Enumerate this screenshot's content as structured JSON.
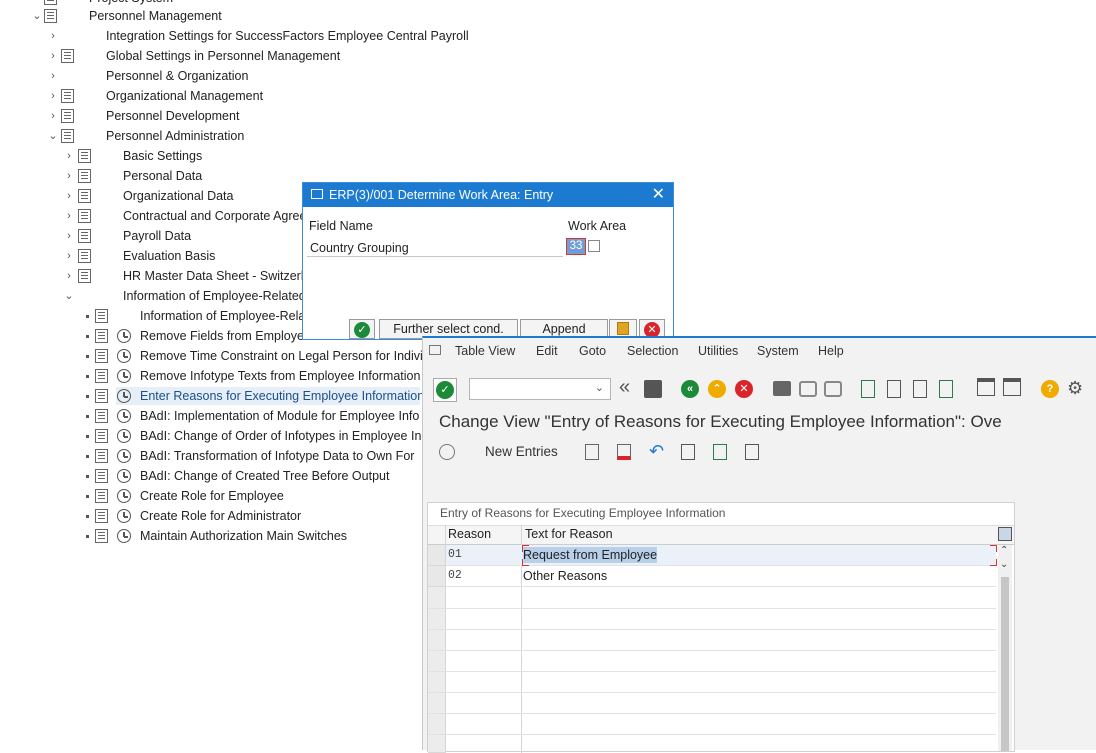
{
  "tree": {
    "top_partial": "Project System",
    "root": "Personnel Management",
    "items": [
      {
        "label": "Integration Settings for SuccessFactors Employee Central Payroll"
      },
      {
        "label": "Global Settings in Personnel Management"
      },
      {
        "label": "Personnel & Organization"
      },
      {
        "label": "Organizational Management"
      },
      {
        "label": "Personnel Development"
      },
      {
        "label": "Personnel Administration"
      },
      {
        "label": "Basic Settings"
      },
      {
        "label": "Personal Data"
      },
      {
        "label": "Organizational Data"
      },
      {
        "label": "Contractual and Corporate Agree"
      },
      {
        "label": "Payroll Data"
      },
      {
        "label": "Evaluation Basis"
      },
      {
        "label": "HR Master Data Sheet - Switzerla"
      },
      {
        "label": "Information of Employee-Related"
      },
      {
        "label": "Information of Employee-Relat"
      },
      {
        "label": "Remove Fields from Employee"
      },
      {
        "label": "Remove Time Constraint on Legal Person for Individ"
      },
      {
        "label": "Remove Infotype Texts from Employee Information"
      },
      {
        "label": "Enter Reasons for Executing Employee Information"
      },
      {
        "label": "BAdI: Implementation of Module for Employee Info"
      },
      {
        "label": "BAdI: Change of Order of Infotypes in Employee In"
      },
      {
        "label": "BAdI: Transformation of Infotype Data to Own For"
      },
      {
        "label": "BAdI: Change of Created Tree Before Output"
      },
      {
        "label": "Create Role for Employee"
      },
      {
        "label": "Create Role for Administrator"
      },
      {
        "label": "Maintain Authorization Main Switches"
      }
    ]
  },
  "popup": {
    "title": "ERP(3)/001 Determine Work Area: Entry",
    "col_field": "Field Name",
    "col_area": "Work Area",
    "field_name": "Country Grouping",
    "field_value": "33",
    "btn_further": "Further select cond.",
    "btn_append": "Append"
  },
  "window": {
    "menu": [
      "Table View",
      "Edit",
      "Goto",
      "Selection",
      "Utilities",
      "System",
      "Help"
    ],
    "title": "Change View \"Entry of Reasons for Executing Employee Information\": Ove",
    "new_entries": "New Entries",
    "table_title": "Entry of Reasons for Executing Employee Information",
    "columns": [
      "Reason",
      "Text for Reason"
    ],
    "rows": [
      {
        "reason": "01",
        "text": "Request from Employee"
      },
      {
        "reason": "02",
        "text": "Other Reasons"
      }
    ]
  },
  "colors": {
    "accent": "#1c7bd1",
    "ok_green": "#1d8a3a",
    "cancel_red": "#d9252a",
    "help_yellow": "#f0ab00"
  }
}
